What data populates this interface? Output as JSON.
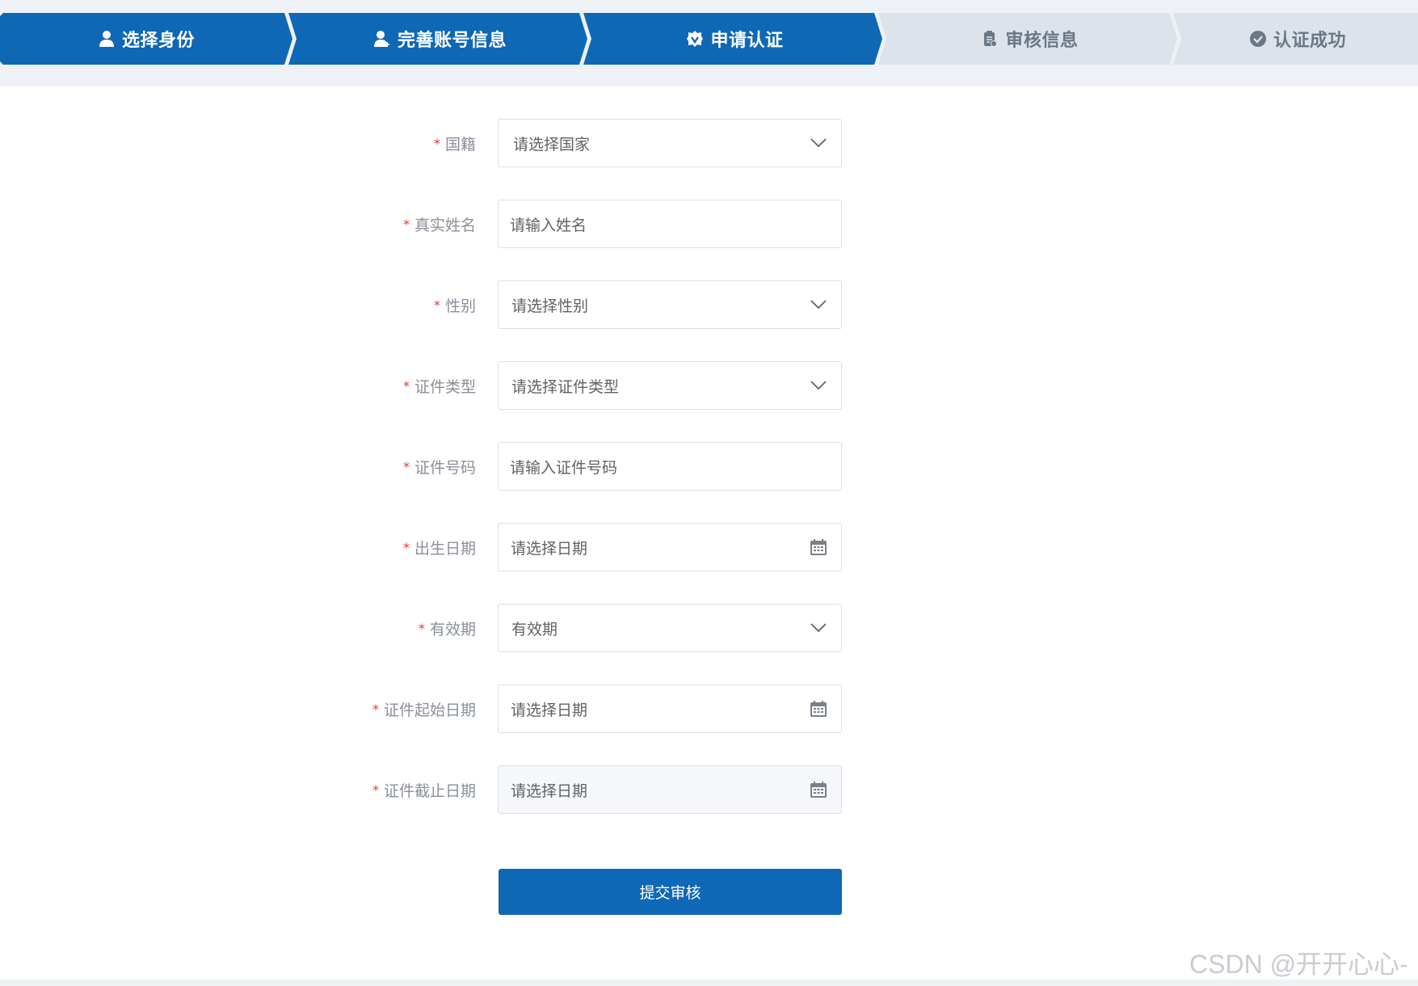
{
  "steps": [
    {
      "label": "选择身份",
      "icon": "user-icon",
      "state": "done"
    },
    {
      "label": "完善账号信息",
      "icon": "user-plus-icon",
      "state": "done"
    },
    {
      "label": "申请认证",
      "icon": "verified-badge-icon",
      "state": "current"
    },
    {
      "label": "审核信息",
      "icon": "clipboard-icon",
      "state": "pending"
    },
    {
      "label": "认证成功",
      "icon": "check-circle-icon",
      "state": "pending"
    }
  ],
  "form": {
    "required_mark": "*",
    "fields": [
      {
        "label": "国籍",
        "type": "select",
        "placeholder": "请选择国家"
      },
      {
        "label": "真实姓名",
        "type": "input",
        "placeholder": "请输入姓名"
      },
      {
        "label": "性别",
        "type": "select",
        "placeholder": "请选择性别"
      },
      {
        "label": "证件类型",
        "type": "select",
        "placeholder": "请选择证件类型"
      },
      {
        "label": "证件号码",
        "type": "input",
        "placeholder": "请输入证件号码"
      },
      {
        "label": "出生日期",
        "type": "date",
        "placeholder": "请选择日期"
      },
      {
        "label": "有效期",
        "type": "select",
        "value": "有效期"
      },
      {
        "label": "证件起始日期",
        "type": "date",
        "placeholder": "请选择日期"
      },
      {
        "label": "证件截止日期",
        "type": "date",
        "placeholder": "请选择日期",
        "disabled": true
      }
    ],
    "submit_label": "提交审核"
  },
  "watermark": "CSDN @开开心心-",
  "colors": {
    "primary": "#0f68b5",
    "step_inactive_bg": "#dde3ea",
    "step_inactive_text": "#6b7785",
    "required": "#e53935"
  }
}
